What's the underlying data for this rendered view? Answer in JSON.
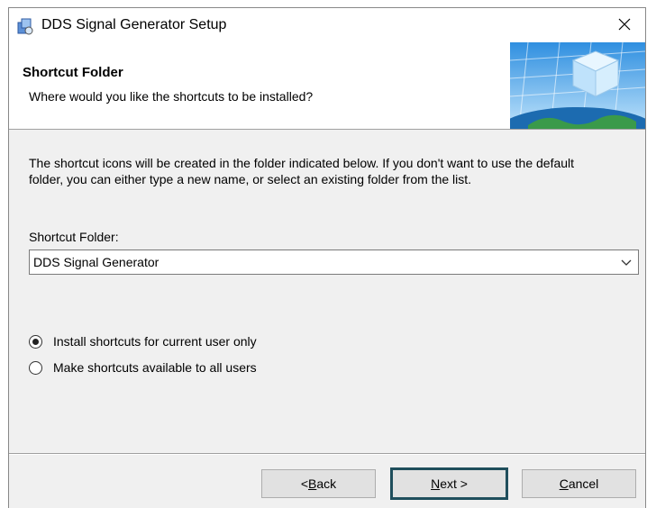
{
  "window": {
    "title": "DDS Signal Generator Setup"
  },
  "header": {
    "title": "Shortcut Folder",
    "subtitle": "Where would you like the shortcuts to be installed?"
  },
  "body": {
    "description_line1": "The shortcut icons will be created in the folder indicated below. If you don't want to use the default",
    "description_line2": "folder, you can either type a new name, or select an existing folder from the list.",
    "folder_label": "Shortcut Folder:",
    "folder_value": "DDS Signal Generator"
  },
  "options": [
    {
      "label": "Install shortcuts for current user only",
      "selected": true
    },
    {
      "label": "Make shortcuts available to all users",
      "selected": false
    }
  ],
  "buttons": {
    "back_prefix": "< ",
    "back_mnemonic": "B",
    "back_rest": "ack",
    "next_mnemonic": "N",
    "next_rest": "ext >",
    "cancel_mnemonic": "C",
    "cancel_rest": "ancel"
  }
}
